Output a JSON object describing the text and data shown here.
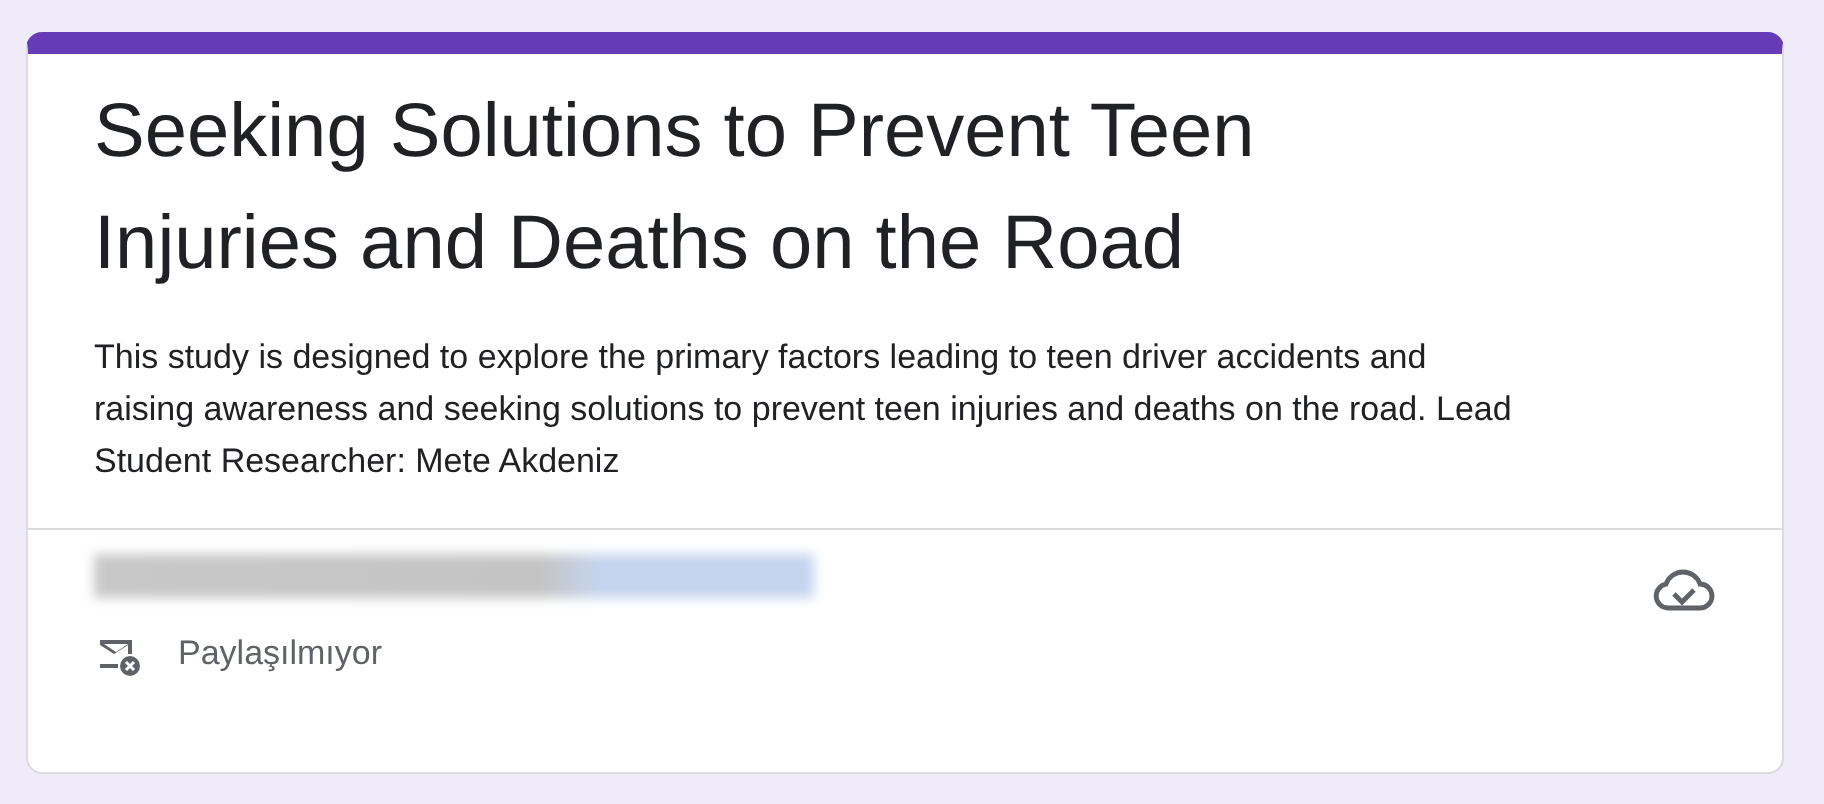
{
  "form": {
    "title": "Seeking Solutions to Prevent Teen Injuries and Deaths on the Road",
    "description": "This study is designed to explore the primary factors leading to teen driver accidents and raising awareness and seeking solutions to prevent teen injuries and deaths on the road. Lead Student Researcher: Mete Akdeniz",
    "email_status": "Paylaşılmıyor"
  }
}
